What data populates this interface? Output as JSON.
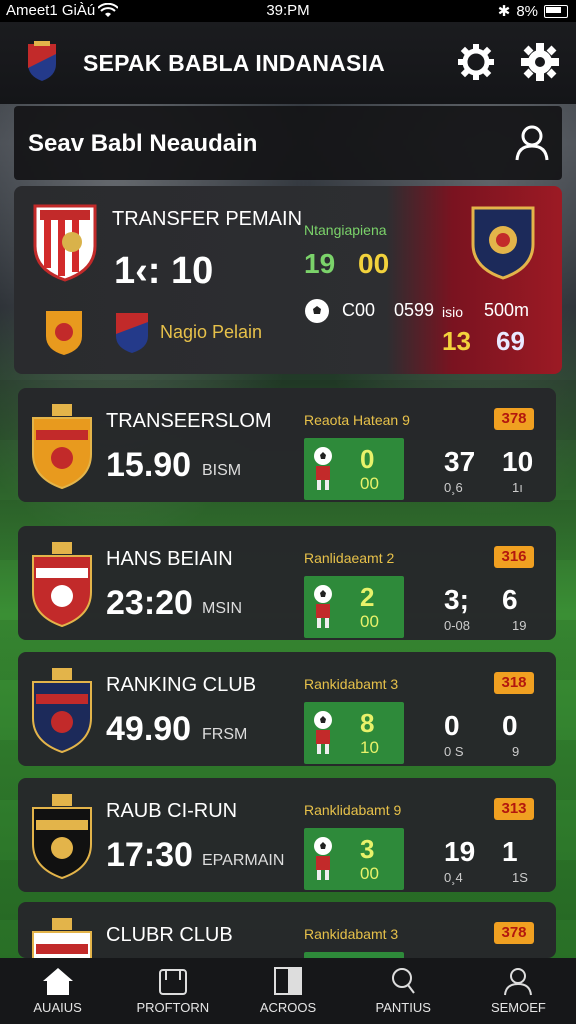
{
  "statusbar": {
    "carrier": "Ameet1 GiÀú",
    "time": "39:PM",
    "battery": "8%"
  },
  "header": {
    "title": "SEPAK BABLA INDANASIA"
  },
  "search": {
    "placeholder": "Seav Babl Neaudain"
  },
  "featured": {
    "title": "TRANSFER PEMAIN",
    "score": "1‹: 10",
    "subtitle": "Nagio Pelain",
    "league": "Ntangiapiena",
    "num_green": "19",
    "num_yellow": "00",
    "stat1": "C00",
    "stat2": "0599",
    "stat3": "isio",
    "stat4": "500m",
    "red1": "13",
    "red2": "69"
  },
  "matches": [
    {
      "title": "TRANSEERSLOM",
      "time": "15.90",
      "sub": "BISM",
      "label": "Reaota Hatean 9",
      "pa": "0",
      "pb": "00",
      "badge": "378",
      "v1": "37",
      "v2": "10",
      "w1": "0¸6",
      "w2": "1ı"
    },
    {
      "title": "HANS BEIAIN",
      "time": "23:20",
      "sub": "MSIN",
      "label": "Ranlidaeamt 2",
      "pa": "2",
      "pb": "00",
      "badge": "316",
      "v1": "3;",
      "v2": "6",
      "w1": "0-08",
      "w2": "19"
    },
    {
      "title": "RANKING CLUB",
      "time": "49.90",
      "sub": "FRSM",
      "label": "Rankidabamt 3",
      "pa": "8",
      "pb": "10",
      "badge": "318",
      "v1": "0",
      "v2": "0",
      "w1": "0 S",
      "w2": "9"
    },
    {
      "title": "RAUB CI-RUN",
      "time": "17:30",
      "sub": "EPARMAIN",
      "label": "Ranklidabamt 9",
      "pa": "3",
      "pb": "00",
      "badge": "313",
      "v1": "19",
      "v2": "1",
      "w1": "0¸4",
      "w2": "1S"
    },
    {
      "title": "CLUBR CLUB",
      "time": "",
      "sub": "",
      "label": "Rankidabamt 3",
      "pa": "",
      "pb": "",
      "badge": "378",
      "v1": "",
      "v2": "",
      "w1": "",
      "w2": ""
    }
  ],
  "nav": [
    {
      "label": "AUAIUS",
      "icon": "home-icon"
    },
    {
      "label": "PROFTORN",
      "icon": "profile-icon"
    },
    {
      "label": "ACROOS",
      "icon": "news-icon"
    },
    {
      "label": "PANTIUS",
      "icon": "search-icon"
    },
    {
      "label": "SEMOEF",
      "icon": "user-icon"
    }
  ],
  "colors": {
    "accent_green": "#2e8a3a",
    "badge": "#f0a021",
    "red": "#9c1a24"
  }
}
